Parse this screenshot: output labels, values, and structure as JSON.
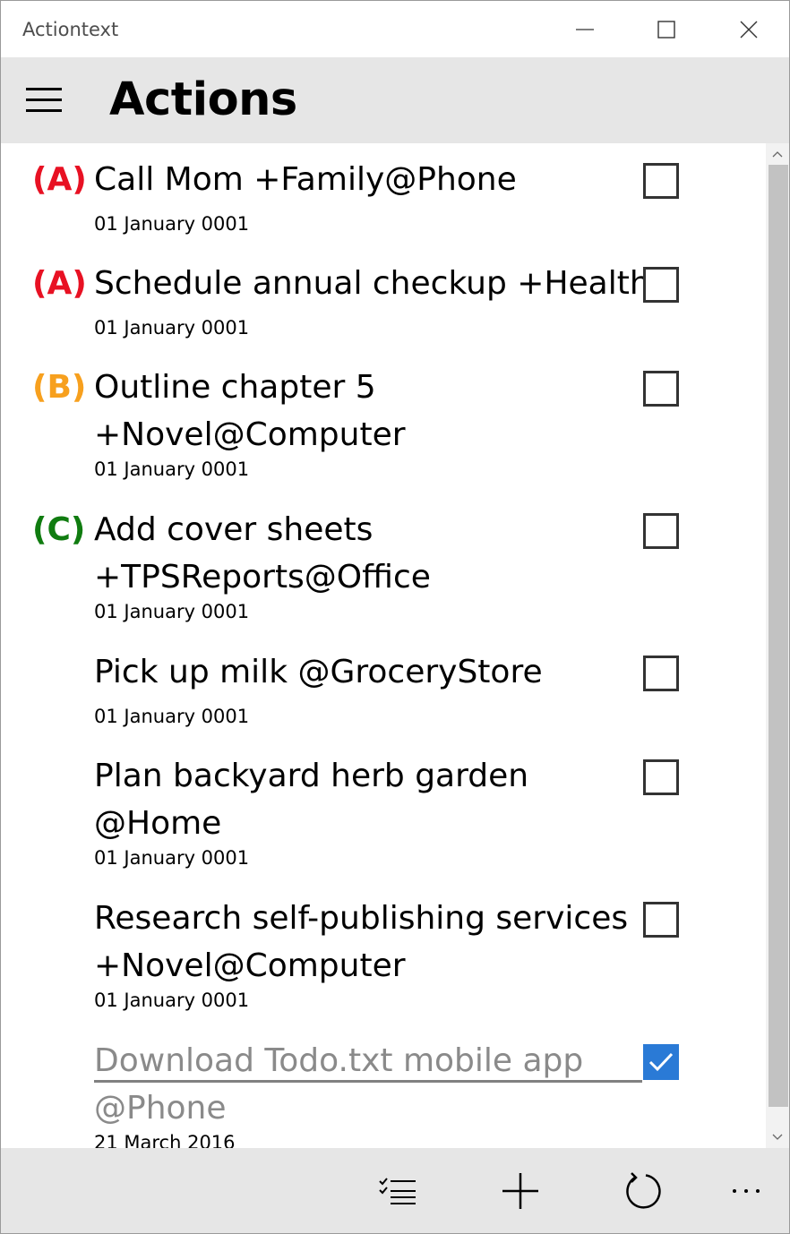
{
  "window": {
    "title": "Actiontext"
  },
  "header": {
    "title": "Actions",
    "menu_icon": "hamburger-menu-icon"
  },
  "colors": {
    "priority_A": "#e81123",
    "priority_B": "#f7a01e",
    "priority_C": "#107c10",
    "accent": "#2a7ad6",
    "header_bg": "#e6e6e6"
  },
  "tasks": [
    {
      "priority": "(A)",
      "priority_level": "A",
      "text": "Call Mom +Family@Phone",
      "date": "01 January 0001",
      "completed": false
    },
    {
      "priority": "(A)",
      "priority_level": "A",
      "text": "Schedule annual checkup +Health",
      "date": "01 January 0001",
      "completed": false
    },
    {
      "priority": "(B)",
      "priority_level": "B",
      "text": "Outline chapter 5 +Novel@Computer",
      "date": "01 January 0001",
      "completed": false
    },
    {
      "priority": "(C)",
      "priority_level": "C",
      "text": "Add cover sheets +TPSReports@Office",
      "date": "01 January 0001",
      "completed": false
    },
    {
      "priority": "",
      "priority_level": "",
      "text": "Pick up milk @GroceryStore",
      "date": "01 January 0001",
      "completed": false
    },
    {
      "priority": "",
      "priority_level": "",
      "text": "Plan backyard herb garden @Home",
      "date": "01 January 0001",
      "completed": false
    },
    {
      "priority": "",
      "priority_level": "",
      "text": "Research self-publishing services +Novel@Computer",
      "date": "01 January 0001",
      "completed": false
    },
    {
      "priority": "",
      "priority_level": "",
      "text": "Download Todo.txt mobile app @Phone",
      "date": "21 March 2016",
      "completed": true
    }
  ],
  "commandbar": {
    "icons": [
      "filter-checklist-icon",
      "add-icon",
      "sync-icon",
      "more-icon"
    ],
    "more_label": "..."
  }
}
